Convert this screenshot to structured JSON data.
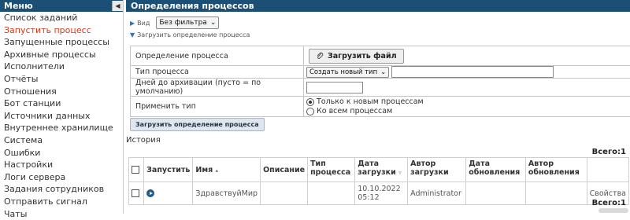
{
  "sidebar": {
    "title": "Меню",
    "toggle": "◀",
    "items": [
      {
        "label": "Список заданий"
      },
      {
        "label": "Запустить процесс",
        "active": true
      },
      {
        "label": "Запущенные процессы"
      },
      {
        "label": "Архивные процессы"
      },
      {
        "label": "Исполнители"
      },
      {
        "label": "Отчёты"
      },
      {
        "label": "Отношения"
      },
      {
        "label": "Бот станции"
      },
      {
        "label": "Источники данных"
      },
      {
        "label": "Внутреннее хранилище"
      },
      {
        "label": "Система"
      },
      {
        "label": "Ошибки"
      },
      {
        "label": "Настройки"
      },
      {
        "label": "Логи сервера"
      },
      {
        "label": "Задания сотрудников"
      },
      {
        "label": "Отправить сигнал"
      },
      {
        "label": "Чаты"
      }
    ]
  },
  "main": {
    "title": "Определения процессов",
    "view": {
      "label": "Вид",
      "filter_value": "Без фильтра"
    },
    "upload_toggle": "Загрузить определение процесса",
    "form": {
      "definition_label": "Определение процесса",
      "upload_file_button": "Загрузить файл",
      "type_label": "Тип процесса",
      "type_select": "Создать новый тип",
      "archive_label": "Дней до архивации (пусто = по умолчанию)",
      "apply_label": "Применить тип",
      "radio_new": "Только к новым процессам",
      "radio_all": "Ко всем процессам"
    },
    "upload_button": "Загрузить определение процесса",
    "history_label": "История",
    "total_top": "Всего:1",
    "total_bottom": "Всего:1",
    "columns": [
      "Запустить",
      "Имя",
      "Описание",
      "Тип процесса",
      "Дата загрузки",
      "Автор загрузки",
      "Дата обновления",
      "Автор обновления"
    ],
    "sort_markers": {
      "name": "▴",
      "date": "▿"
    },
    "rows": [
      {
        "name": "ЗдравствуйМир",
        "description": "",
        "type": "",
        "upload_date": "10.10.2022 05:12",
        "upload_author": "Administrator",
        "update_date": "",
        "update_author": "",
        "action": "Свойства"
      }
    ]
  },
  "colors": {
    "header_bg": "#1c4f76",
    "active_item": "#d03a1a"
  }
}
